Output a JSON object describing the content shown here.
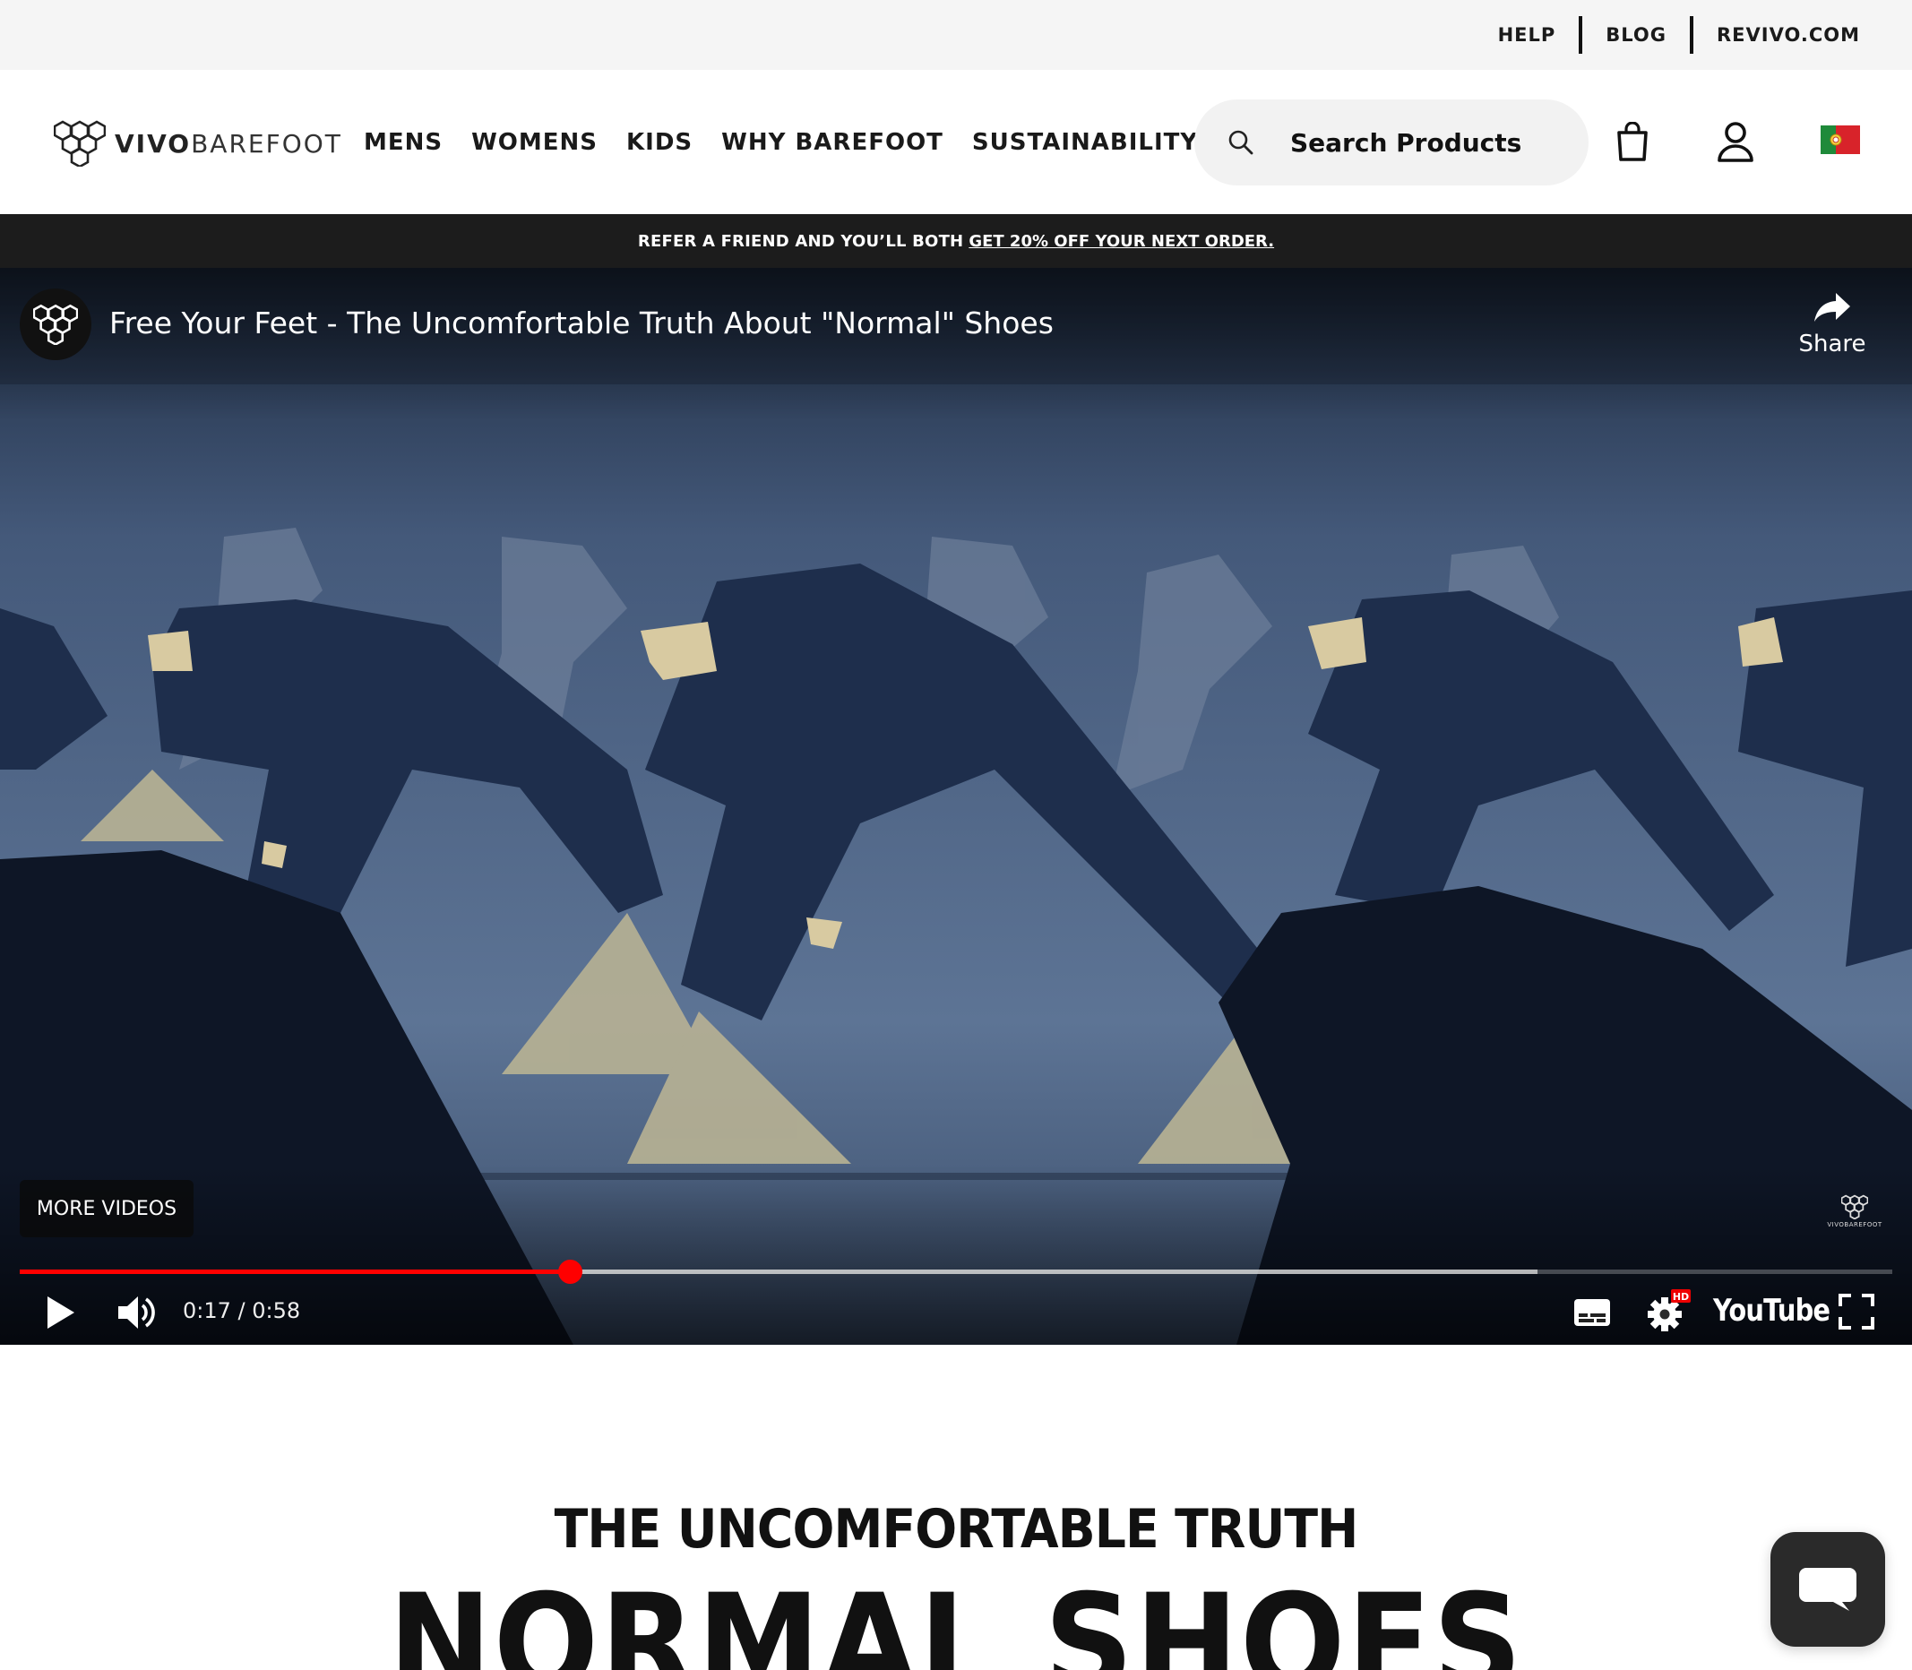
{
  "utility_nav": {
    "help": "HELP",
    "blog": "BLOG",
    "revivo": "REVIVO.COM"
  },
  "brand": {
    "logo_bold": "VIVO",
    "logo_light": "BAREFOOT"
  },
  "main_nav": {
    "items": [
      "MENS",
      "WOMENS",
      "KIDS",
      "WHY BAREFOOT",
      "SUSTAINABILITY"
    ]
  },
  "search": {
    "placeholder": "Search Products"
  },
  "header_icons": {
    "bag": "shopping-bag-icon",
    "account": "account-icon",
    "flag": "portugal-flag-icon"
  },
  "promo": {
    "text": "REFER A FRIEND AND YOU’LL BOTH",
    "link": "GET 20% OFF YOUR NEXT ORDER."
  },
  "video": {
    "title": "Free Your Feet - The Uncomfortable Truth About \"Normal\" Shoes",
    "share_label": "Share",
    "more_videos_label": "MORE VIDEOS",
    "watermark": "VIVOBAREFOOT",
    "time": "0:17 / 0:58",
    "played_fraction": 0.2936,
    "buffered_fraction": 0.8105,
    "youtube_label": "YouTube",
    "hd_badge": "HD",
    "colors": {
      "progress": "#ff0000"
    }
  },
  "page": {
    "heading": "THE UNCOMFORTABLE TRUTH",
    "headline": "NORMAL SHOES"
  },
  "chat": {
    "icon": "chat-bubble-icon"
  }
}
